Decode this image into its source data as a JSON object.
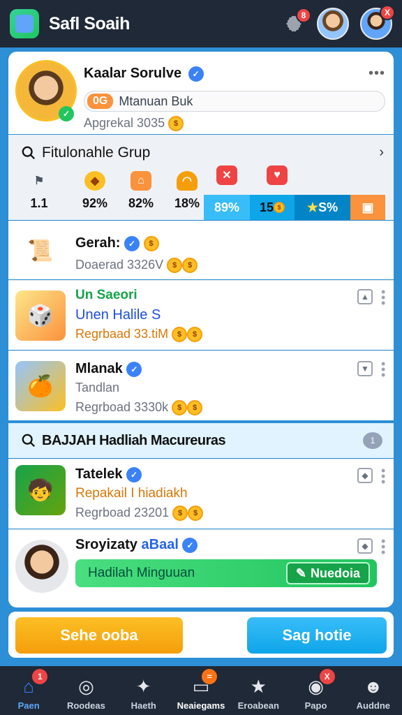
{
  "header": {
    "title": "Safl Soaih",
    "settings_badge": "8",
    "avatar_close_badge": "X",
    "icons": [
      "app-logo-icon",
      "gear-icon",
      "user-avatar",
      "close-icon"
    ]
  },
  "profile": {
    "name": "Kaalar Sorulve",
    "search_tag": "0G",
    "search_text": "Mtanuan Buk",
    "subtitle": "Apgrekal 3035"
  },
  "features": {
    "title": "Fitulonahle Grup",
    "items": [
      {
        "value": "1.1"
      },
      {
        "value": "92%"
      },
      {
        "value": "82%"
      },
      {
        "value": "18%"
      }
    ],
    "buttons": [
      {
        "label": "89%",
        "color": "#38bdf8"
      },
      {
        "label": "15",
        "color": "#0ea5e9"
      },
      {
        "label": "S%",
        "color": "#0284c7"
      },
      {
        "label": "",
        "color": "#fb923c"
      }
    ]
  },
  "list": [
    {
      "name": "Gerah:",
      "sub": "Doaerad 3326V"
    },
    {
      "name": "Un Saeori",
      "sub2": "Unen Halile S",
      "sub": "Regrbaad 33.tiM"
    },
    {
      "name": "Mlanak",
      "sub2": "Tandlan",
      "sub": "Regrboad 3330k"
    },
    {
      "name": "Tatelek",
      "sub2": "Repakail I hiadiakh",
      "sub": "Regrboad 23201"
    },
    {
      "name": "Sroyizaty",
      "name2": "aBaal",
      "green_text": "Hadilah Minguuan",
      "green_button": "Nuedoia"
    }
  ],
  "section": {
    "title": "BAJJAH Hadliah Macureuras"
  },
  "actions": {
    "primary": "Sehe ooba",
    "secondary": "Sag hotie"
  },
  "nav": [
    {
      "label": "Paen",
      "badge": "1",
      "icon": "home-icon"
    },
    {
      "label": "Roodeas",
      "icon": "target-icon"
    },
    {
      "label": "Haeth",
      "icon": "controller-icon"
    },
    {
      "label": "Neaiegams",
      "badge": "=",
      "icon": "chat-icon"
    },
    {
      "label": "Eroabean",
      "icon": "star-icon"
    },
    {
      "label": "Papo",
      "badge": "X",
      "icon": "record-icon"
    },
    {
      "label": "Auddne",
      "icon": "profile-icon"
    }
  ],
  "colors": {
    "accent_blue": "#2d8fd6",
    "accent_orange": "#f59e0b",
    "accent_green": "#22c55e",
    "badge_red": "#ef4444"
  }
}
